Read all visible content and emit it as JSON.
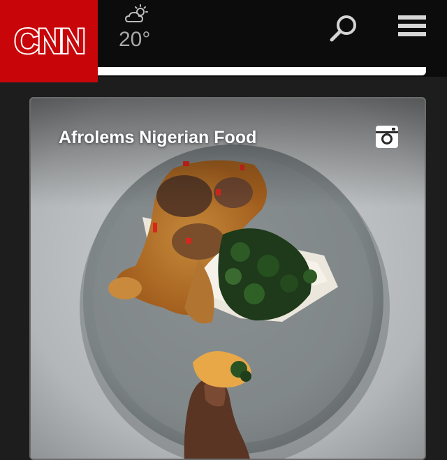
{
  "header": {
    "logo_text": "CNN",
    "weather": {
      "icon": "partly-cloudy-icon",
      "temperature": "20°"
    },
    "search_icon": "search-icon",
    "menu_icon": "hamburger-menu-icon"
  },
  "card": {
    "title": "Afrolems Nigerian Food",
    "source_icon": "instagram-icon"
  },
  "colors": {
    "brand_red": "#c8060a",
    "header_bg": "#0c0c0c",
    "page_bg": "#1d1d1d"
  }
}
